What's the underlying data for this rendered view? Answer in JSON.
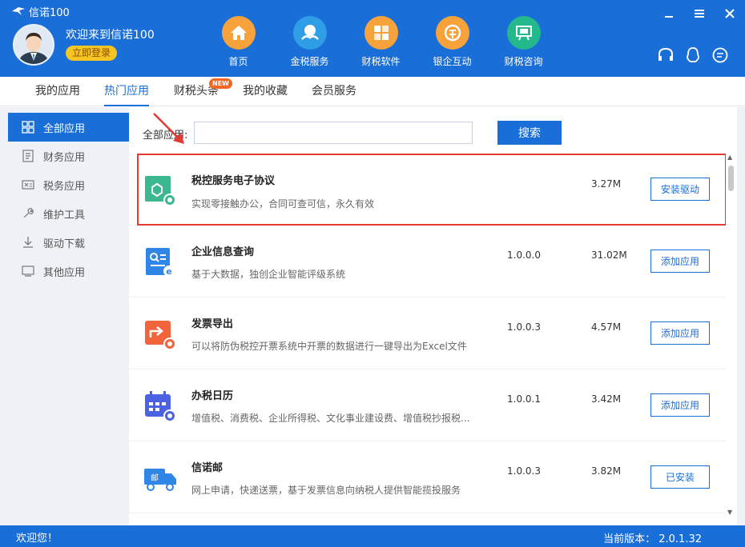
{
  "app": {
    "title": "信诺100"
  },
  "user": {
    "welcome": "欢迎来到信诺100",
    "login_label": "立即登录"
  },
  "nav": [
    {
      "label": "首页",
      "icon": "home-icon",
      "color": "#f7a23b"
    },
    {
      "label": "金税服务",
      "icon": "tax-service-icon",
      "color": "#2f9ee6"
    },
    {
      "label": "财税软件",
      "icon": "software-icon",
      "color": "#f7a23b"
    },
    {
      "label": "银企互动",
      "icon": "bank-icon",
      "color": "#f7a23b"
    },
    {
      "label": "财税咨询",
      "icon": "consult-icon",
      "color": "#23b98d"
    }
  ],
  "tabs": [
    {
      "label": "我的应用"
    },
    {
      "label": "热门应用"
    },
    {
      "label": "财税头条"
    },
    {
      "label": "我的收藏"
    },
    {
      "label": "会员服务"
    }
  ],
  "new_badge": "NEW",
  "sidebar": [
    {
      "label": "全部应用",
      "icon": "grid-icon"
    },
    {
      "label": "财务应用",
      "icon": "finance-icon"
    },
    {
      "label": "税务应用",
      "icon": "tax-icon"
    },
    {
      "label": "维护工具",
      "icon": "wrench-icon"
    },
    {
      "label": "驱动下载",
      "icon": "download-icon"
    },
    {
      "label": "其他应用",
      "icon": "other-icon"
    }
  ],
  "search": {
    "label": "全部应用:",
    "value": "",
    "button": "搜索"
  },
  "apps": [
    {
      "name": "税控服务电子协议",
      "desc": "实现零接触办公，合同可查可信，永久有效",
      "version": "",
      "size": "3.27M",
      "action": "安装驱动"
    },
    {
      "name": "企业信息查询",
      "desc": "基于大数据，独创企业智能评级系统",
      "version": "1.0.0.0",
      "size": "31.02M",
      "action": "添加应用"
    },
    {
      "name": "发票导出",
      "desc": "可以将防伪税控开票系统中开票的数据进行一键导出为Excel文件",
      "version": "1.0.0.3",
      "size": "4.57M",
      "action": "添加应用"
    },
    {
      "name": "办税日历",
      "desc": "增值税、消费税、企业所得税、文化事业建设费、增值税抄报税...",
      "version": "1.0.0.1",
      "size": "3.42M",
      "action": "添加应用"
    },
    {
      "name": "信诺邮",
      "desc": "网上申请，快递送票，基于发票信息向纳税人提供智能揽投服务",
      "version": "1.0.0.3",
      "size": "3.82M",
      "action": "已安装"
    }
  ],
  "status": {
    "left": "欢迎您！",
    "right": "当前版本： 2.0.1.32"
  }
}
